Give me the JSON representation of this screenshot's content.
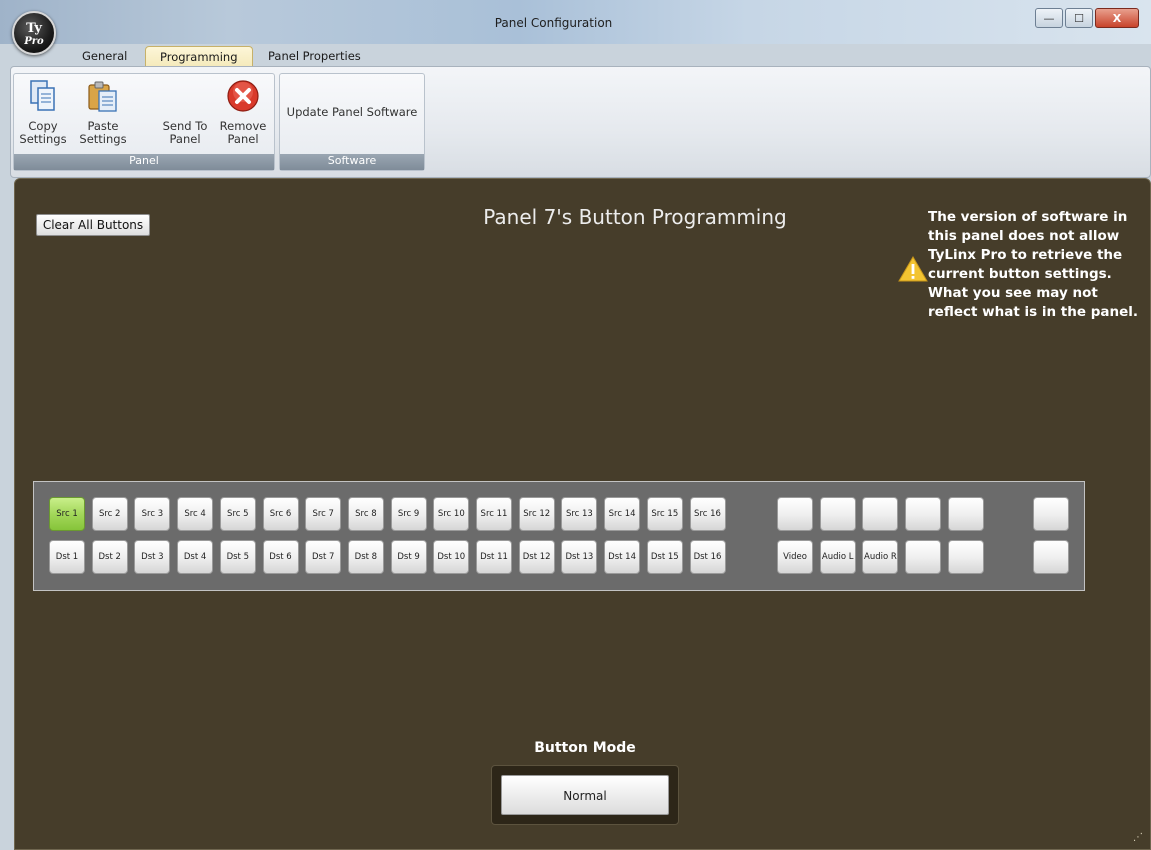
{
  "window": {
    "title": "Panel Configuration",
    "app_logo_top": "Ty",
    "app_logo_bottom": "Pro",
    "controls": {
      "minimize": "—",
      "maximize": "☐",
      "close": "X"
    }
  },
  "tabs": [
    {
      "label": "General"
    },
    {
      "label": "Programming",
      "active": true
    },
    {
      "label": "Panel Properties"
    }
  ],
  "ribbon": {
    "panel_group": {
      "label": "Panel",
      "buttons": [
        {
          "label": "Copy Settings",
          "icon": "copy-icon"
        },
        {
          "label": "Paste Settings",
          "icon": "paste-icon"
        },
        {
          "label": "Send To Panel",
          "icon": "send-icon"
        },
        {
          "label": "Remove Panel",
          "icon": "remove-icon"
        }
      ]
    },
    "software_group": {
      "label": "Software",
      "buttons": [
        {
          "label": "Update Panel Software"
        }
      ]
    }
  },
  "main": {
    "clear_button": "Clear All Buttons",
    "title": "Panel 7's Button Programming",
    "warning": "The version of software in this panel does not allow TyLinx Pro to retrieve the current button settings. What you see may not reflect what is in the panel.",
    "src_buttons": [
      "Src 1",
      "Src 2",
      "Src 3",
      "Src 4",
      "Src 5",
      "Src 6",
      "Src 7",
      "Src 8",
      "Src 9",
      "Src 10",
      "Src 11",
      "Src 12",
      "Src 13",
      "Src 14",
      "Src 15",
      "Src 16"
    ],
    "dst_buttons": [
      "Dst 1",
      "Dst 2",
      "Dst 3",
      "Dst 4",
      "Dst 5",
      "Dst 6",
      "Dst 7",
      "Dst 8",
      "Dst 9",
      "Dst 10",
      "Dst 11",
      "Dst 12",
      "Dst 13",
      "Dst 14",
      "Dst 15",
      "Dst 16"
    ],
    "extra_top": [
      "",
      "",
      "",
      "",
      ""
    ],
    "extra_bottom": [
      "Video",
      "Audio L",
      "Audio R",
      "",
      ""
    ],
    "side_buttons": [
      "",
      ""
    ],
    "lit_button": "Src 1",
    "button_mode_label": "Button Mode",
    "button_mode_value": "Normal"
  },
  "colors": {
    "panel_bg": "#463d2a",
    "lit": "#a3d75a"
  }
}
